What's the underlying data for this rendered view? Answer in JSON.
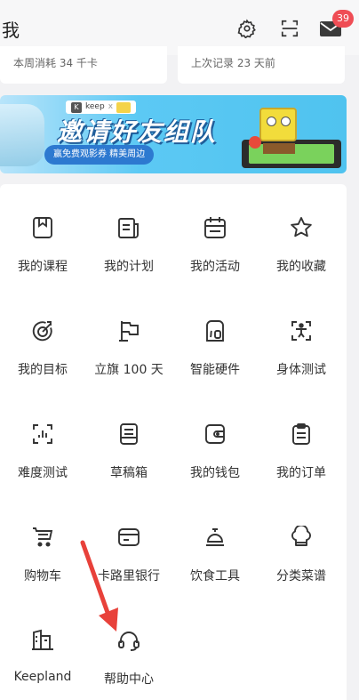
{
  "header": {
    "title": "我",
    "mail_badge": "39"
  },
  "stats": {
    "left": "本周消耗 34 千卡",
    "right": "上次记录 23 天前"
  },
  "banner": {
    "brand": "keep",
    "brand_x": "x",
    "title": "邀请好友组队",
    "pill": "赢免费观影券 精美周边"
  },
  "menu": {
    "items": [
      {
        "label": "我的课程",
        "icon": "bookmark-icon"
      },
      {
        "label": "我的计划",
        "icon": "plan-icon"
      },
      {
        "label": "我的活动",
        "icon": "calendar-icon"
      },
      {
        "label": "我的收藏",
        "icon": "star-icon"
      },
      {
        "label": "我的目标",
        "icon": "target-icon"
      },
      {
        "label": "立旗 100 天",
        "icon": "flag-icon"
      },
      {
        "label": "智能硬件",
        "icon": "device-icon"
      },
      {
        "label": "身体测试",
        "icon": "body-scan-icon"
      },
      {
        "label": "难度测试",
        "icon": "difficulty-icon"
      },
      {
        "label": "草稿箱",
        "icon": "drafts-icon"
      },
      {
        "label": "我的钱包",
        "icon": "wallet-icon"
      },
      {
        "label": "我的订单",
        "icon": "order-icon"
      },
      {
        "label": "购物车",
        "icon": "cart-icon"
      },
      {
        "label": "卡路里银行",
        "icon": "card-icon"
      },
      {
        "label": "饮食工具",
        "icon": "cloche-icon"
      },
      {
        "label": "分类菜谱",
        "icon": "chef-hat-icon"
      },
      {
        "label": "Keepland",
        "icon": "building-icon"
      },
      {
        "label": "帮助中心",
        "icon": "headset-icon"
      }
    ]
  },
  "colors": {
    "badge": "#ef4d55",
    "arrow": "#e8413a"
  }
}
